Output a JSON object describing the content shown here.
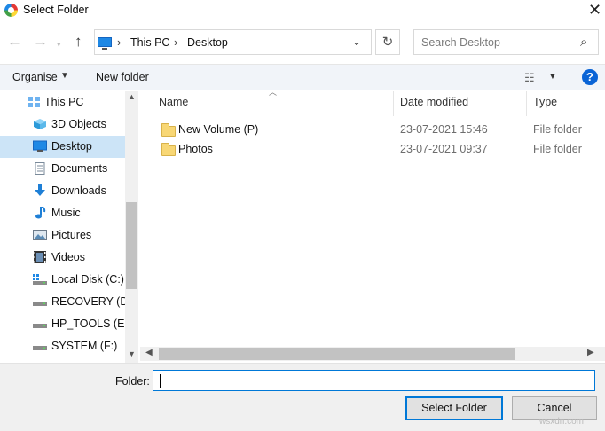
{
  "window": {
    "title": "Select Folder"
  },
  "nav": {
    "breadcrumb": [
      "This PC",
      "Desktop"
    ],
    "search_placeholder": "Search Desktop"
  },
  "toolbar": {
    "organise_label": "Organise",
    "new_folder_label": "New folder"
  },
  "sidebar": {
    "items": [
      {
        "label": "This PC",
        "icon": "computer-icon",
        "selected": false
      },
      {
        "label": "3D Objects",
        "icon": "cube-3d-icon",
        "selected": false
      },
      {
        "label": "Desktop",
        "icon": "desktop-icon",
        "selected": true
      },
      {
        "label": "Documents",
        "icon": "document-icon",
        "selected": false
      },
      {
        "label": "Downloads",
        "icon": "download-arrow-icon",
        "selected": false
      },
      {
        "label": "Music",
        "icon": "music-note-icon",
        "selected": false
      },
      {
        "label": "Pictures",
        "icon": "picture-icon",
        "selected": false
      },
      {
        "label": "Videos",
        "icon": "film-icon",
        "selected": false
      },
      {
        "label": "Local Disk (C:)",
        "icon": "windows-drive-icon",
        "selected": false
      },
      {
        "label": "RECOVERY (D:)",
        "icon": "drive-icon",
        "selected": false
      },
      {
        "label": "HP_TOOLS (E:)",
        "icon": "drive-icon",
        "selected": false
      },
      {
        "label": "SYSTEM (F:)",
        "icon": "drive-icon",
        "selected": false
      }
    ]
  },
  "file_list": {
    "columns": [
      "Name",
      "Date modified",
      "Type"
    ],
    "rows": [
      {
        "name": "New Volume (P)",
        "date": "23-07-2021 15:46",
        "type": "File folder"
      },
      {
        "name": "Photos",
        "date": "23-07-2021 09:37",
        "type": "File folder"
      }
    ]
  },
  "footer": {
    "folder_label": "Folder:",
    "folder_value": "",
    "select_label": "Select Folder",
    "cancel_label": "Cancel"
  },
  "watermark": "wsxdn.com",
  "colors": {
    "accent": "#0078d7",
    "selected_bg": "#cce4f7",
    "folder": "#f8d775"
  }
}
